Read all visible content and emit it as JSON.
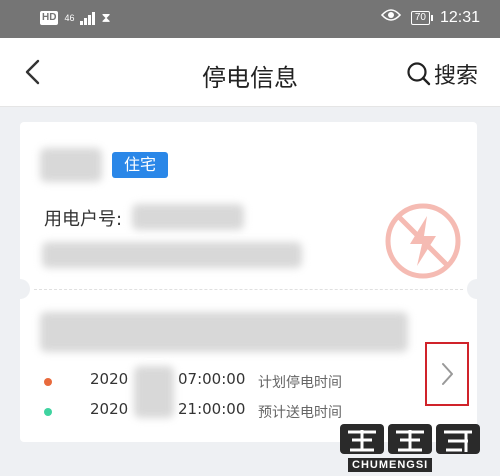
{
  "status_bar": {
    "hd": "HD",
    "network": "46",
    "battery": "70",
    "time": "12:31"
  },
  "nav": {
    "title": "停电信息",
    "search_label": "搜索"
  },
  "card": {
    "tag": "住宅",
    "account_label": "用电户号:",
    "stamp_icon": "no-power-icon",
    "schedule": [
      {
        "year": "2020",
        "time": "07:00:00",
        "label": "计划停电时间",
        "dot_color": "#e86a3c"
      },
      {
        "year": "2020",
        "time": "21:00:00",
        "label": "预计送电时间",
        "dot_color": "#3fd3a0"
      }
    ]
  },
  "watermark": {
    "text": "CHUMENGSI"
  },
  "colors": {
    "accent": "#2a87e8",
    "highlight": "#d0232a",
    "stamp": "#f2a59a"
  }
}
